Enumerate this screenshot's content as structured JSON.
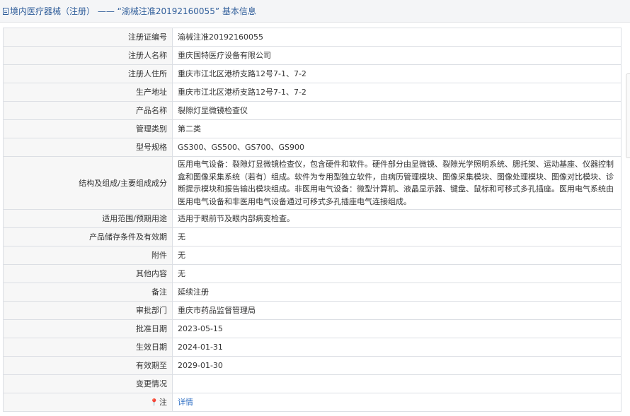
{
  "header": {
    "title": "境内医疗器械（注册） —— “渝械注准20192160055” 基本信息"
  },
  "rows": [
    {
      "label": "注册证编号",
      "value": "渝械注准20192160055"
    },
    {
      "label": "注册人名称",
      "value": "重庆国特医疗设备有限公司"
    },
    {
      "label": "注册人住所",
      "value": "重庆市江北区港桥支路12号7-1、7-2"
    },
    {
      "label": "生产地址",
      "value": "重庆市江北区港桥支路12号7-1、7-2"
    },
    {
      "label": "产品名称",
      "value": "裂隙灯显微镜检查仪"
    },
    {
      "label": "管理类别",
      "value": "第二类"
    },
    {
      "label": "型号规格",
      "value": "GS300、GS500、GS700、GS900"
    },
    {
      "label": "结构及组成/主要组成成分",
      "value": "医用电气设备：裂隙灯显微镜检查仪，包含硬件和软件。硬件部分由显微镜、裂隙光学照明系统、腮托架、运动基座、仪器控制盒和图像采集系统（若有）组成。软件为专用型独立软件，由病历管理模块、图像采集模块、图像处理模块、图像对比模块、诊断提示模块和报告输出模块组成。非医用电气设备：微型计算机、液晶显示器、键盘、鼠标和可移式多孔插座。医用电气系统由医用电气设备和非医用电气设备通过可移式多孔插座电气连接组成。"
    },
    {
      "label": "适用范围/预期用途",
      "value": "适用于眼前节及眼内部病变检查。"
    },
    {
      "label": "产品储存条件及有效期",
      "value": "无"
    },
    {
      "label": "附件",
      "value": "无"
    },
    {
      "label": "其他内容",
      "value": "无"
    },
    {
      "label": "备注",
      "value": "延续注册"
    },
    {
      "label": "审批部门",
      "value": "重庆市药品监督管理局"
    },
    {
      "label": "批准日期",
      "value": "2023-05-15"
    },
    {
      "label": "生效日期",
      "value": "2024-01-31"
    },
    {
      "label": "有效期至",
      "value": "2029-01-30"
    },
    {
      "label": "变更情况",
      "value": ""
    }
  ],
  "note": {
    "label": "注",
    "icon": "pin-icon",
    "link_text": "详情"
  },
  "colors": {
    "title": "#2f5d9a",
    "link": "#2f6fc4",
    "label_bg": "#f7f7f7",
    "border": "#dcdfe4"
  }
}
